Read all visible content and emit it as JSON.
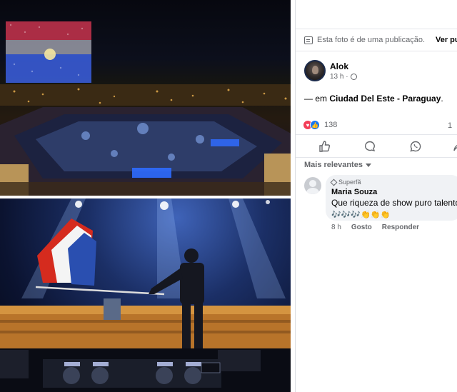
{
  "photo": {
    "top_alt": "Aerial night view of stadium concert with drone flag",
    "bottom_alt": "DJ waving Paraguay flag on stage in front of crowd"
  },
  "notice": {
    "text": "Esta foto é de uma publicação.",
    "link": "Ver pul"
  },
  "post": {
    "author": "Alok",
    "time": "13 h ·",
    "caption_prefix": "— em ",
    "caption_place": "Ciudad Del Este - Paraguay",
    "caption_suffix": "."
  },
  "reactions": {
    "count": "138",
    "comments_count": "1"
  },
  "comments": {
    "sort_label": "Mais relevantes",
    "items": [
      {
        "badge": "Superfã",
        "name": "Maria Souza",
        "text": "Que riqueza de show puro talento",
        "emoji": "🎶🎶🎶👏👏👏",
        "time": "8 h",
        "like": "Gosto",
        "reply": "Responder"
      }
    ]
  },
  "colors": {
    "brand": "#1877f2",
    "heart": "#f33e58",
    "secondary_text": "#65676b"
  }
}
